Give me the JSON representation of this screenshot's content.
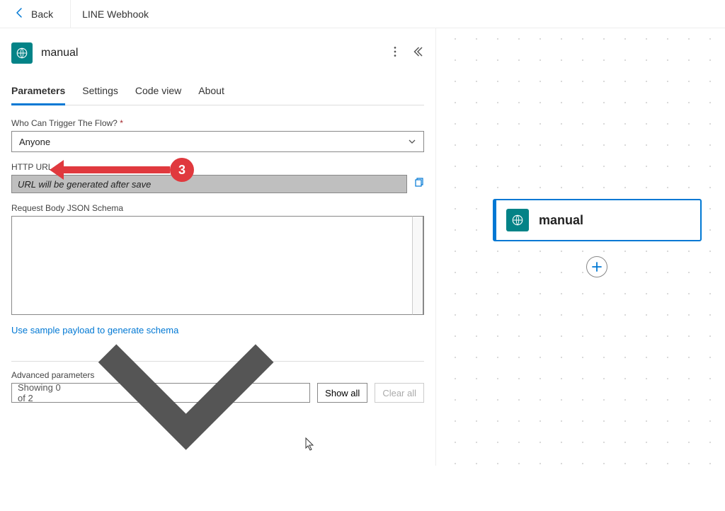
{
  "header": {
    "back_label": "Back",
    "title": "LINE Webhook"
  },
  "node": {
    "title": "manual"
  },
  "tabs": [
    {
      "label": "Parameters",
      "active": true
    },
    {
      "label": "Settings",
      "active": false
    },
    {
      "label": "Code view",
      "active": false
    },
    {
      "label": "About",
      "active": false
    }
  ],
  "fields": {
    "trigger_label": "Who Can Trigger The Flow?",
    "trigger_value": "Anyone",
    "http_url_label": "HTTP URL",
    "http_url_value": "URL will be generated after save",
    "schema_label": "Request Body JSON Schema",
    "schema_value": "",
    "schema_link": "Use sample payload to generate schema"
  },
  "advanced": {
    "label": "Advanced parameters",
    "summary": "Showing 0 of 2",
    "show_all": "Show all",
    "clear_all": "Clear all"
  },
  "annotation": {
    "number": "3"
  },
  "canvas": {
    "node_title": "manual"
  }
}
